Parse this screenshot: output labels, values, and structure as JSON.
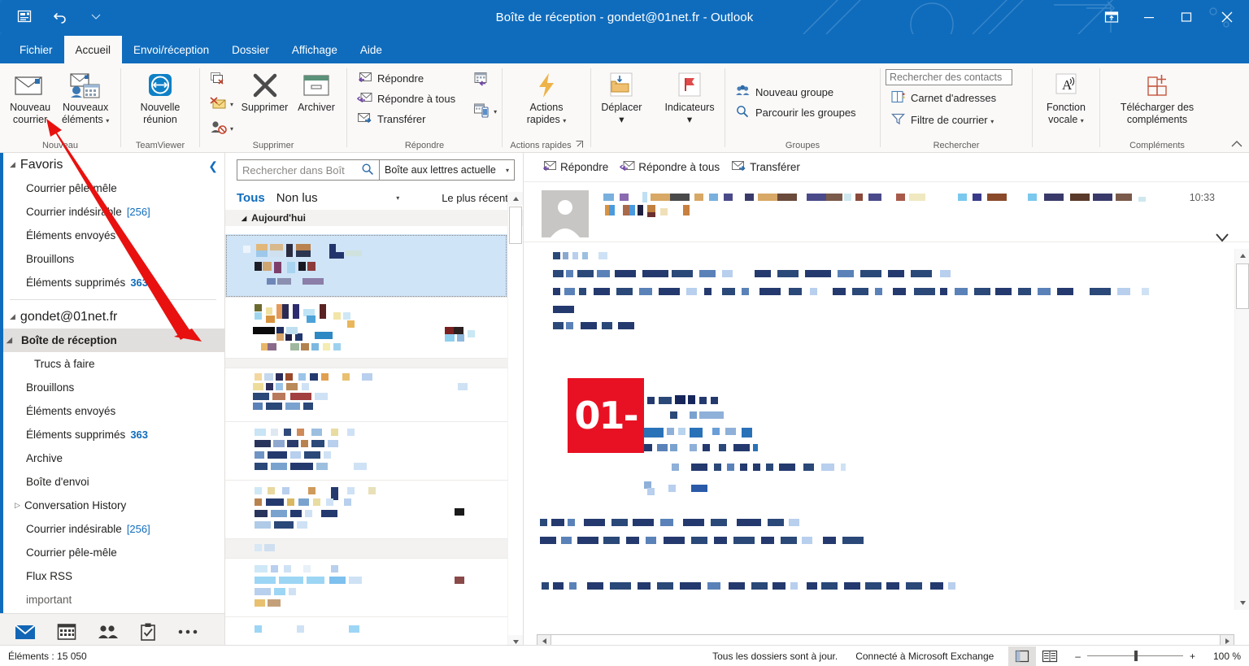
{
  "window": {
    "title": "Boîte de réception - gondet@01net.fr  -  Outlook",
    "qat": {
      "save_icon": "save-icon",
      "undo_icon": "undo-icon",
      "customize_icon": "chevron-down-icon"
    },
    "controls": {
      "ribbon_display": "ribbon-display-options-icon",
      "minimize": "–",
      "maximize": "☐",
      "close": "✕"
    },
    "accent_color": "#0f6cbd"
  },
  "tabs": [
    {
      "label": "Fichier",
      "active": false
    },
    {
      "label": "Accueil",
      "active": true
    },
    {
      "label": "Envoi/réception",
      "active": false
    },
    {
      "label": "Dossier",
      "active": false
    },
    {
      "label": "Affichage",
      "active": false
    },
    {
      "label": "Aide",
      "active": false
    }
  ],
  "ribbon": {
    "collapse_icon": "chevron-up-icon",
    "groups": [
      {
        "label": "Nouveau",
        "items": [
          {
            "label": "Nouveau courrier",
            "icon": "new-mail-icon",
            "type": "big"
          },
          {
            "label": "Nouveaux éléments",
            "icon": "new-items-icon",
            "type": "big",
            "caret": true
          }
        ]
      },
      {
        "label": "TeamViewer",
        "items": [
          {
            "label": "Nouvelle réunion",
            "icon": "teamviewer-icon",
            "type": "big"
          }
        ]
      },
      {
        "label": "Supprimer",
        "items": [
          {
            "label": "",
            "icon": "ignore-icon",
            "type": "icon"
          },
          {
            "label": "",
            "icon": "clean-up-icon",
            "type": "icon",
            "caret": true
          },
          {
            "label": "",
            "icon": "junk-icon",
            "type": "icon",
            "caret": true
          },
          {
            "label": "Supprimer",
            "icon": "delete-x-icon",
            "type": "big"
          },
          {
            "label": "Archiver",
            "icon": "archive-icon",
            "type": "big"
          }
        ]
      },
      {
        "label": "Répondre",
        "items": [
          {
            "label": "Répondre",
            "icon": "reply-icon",
            "type": "small"
          },
          {
            "label": "Répondre à tous",
            "icon": "reply-all-icon",
            "type": "small"
          },
          {
            "label": "Transférer",
            "icon": "forward-icon",
            "type": "small"
          },
          {
            "label": "",
            "icon": "meeting-reply-icon",
            "type": "icon"
          },
          {
            "label": "",
            "icon": "more-respond-icon",
            "type": "icon",
            "caret": true
          }
        ]
      },
      {
        "label": "Actions rapides",
        "dialog_launcher": true,
        "items": [
          {
            "label": "Actions rapides",
            "icon": "quick-steps-lightning-icon",
            "type": "big",
            "caret": true
          }
        ]
      },
      {
        "label": "",
        "items": [
          {
            "label": "Déplacer",
            "icon": "move-folder-icon",
            "type": "big",
            "caret": true
          },
          {
            "label": "Indicateurs",
            "icon": "flag-icon",
            "type": "big",
            "caret": true
          }
        ]
      },
      {
        "label": "Groupes",
        "items": [
          {
            "label": "Nouveau groupe",
            "icon": "new-group-icon",
            "type": "small"
          },
          {
            "label": "Parcourir les groupes",
            "icon": "browse-groups-icon",
            "type": "small"
          }
        ]
      },
      {
        "label": "Rechercher",
        "search_contacts_placeholder": "Rechercher des contacts",
        "items": [
          {
            "label": "Carnet d'adresses",
            "icon": "address-book-icon",
            "type": "small"
          },
          {
            "label": "Filtre de courrier",
            "icon": "filter-funnel-icon",
            "type": "small",
            "caret": true
          }
        ]
      },
      {
        "label": "",
        "items": [
          {
            "label": "Fonction vocale",
            "icon": "read-aloud-icon",
            "type": "big",
            "caret": true
          }
        ]
      },
      {
        "label": "Compléments",
        "items": [
          {
            "label": "Télécharger des compléments",
            "icon": "get-addins-icon",
            "type": "big"
          }
        ]
      }
    ]
  },
  "navpane": {
    "collapse_icon": "chevron-left-icon",
    "favorites": {
      "label": "Favoris",
      "items": [
        {
          "label": "Courrier pêle-mêle",
          "count": "",
          "count_style": ""
        },
        {
          "label": "Courrier indésirable",
          "count": "[256]",
          "count_style": "brackets"
        },
        {
          "label": "Éléments envoyés",
          "count": "",
          "count_style": ""
        },
        {
          "label": "Brouillons",
          "count": "",
          "count_style": ""
        },
        {
          "label": "Éléments supprimés",
          "count": "363",
          "count_style": "bold"
        }
      ]
    },
    "account": {
      "label": "gondet@01net.fr",
      "items": [
        {
          "label": "Boîte de réception",
          "count": "",
          "selected": true,
          "expandable": true,
          "indent": 0
        },
        {
          "label": "Trucs à faire",
          "count": "",
          "selected": false,
          "expandable": false,
          "indent": 1
        },
        {
          "label": "Brouillons",
          "count": "",
          "selected": false,
          "expandable": false,
          "indent": 0
        },
        {
          "label": "Éléments envoyés",
          "count": "",
          "selected": false,
          "expandable": false,
          "indent": 0
        },
        {
          "label": "Éléments supprimés",
          "count": "363",
          "selected": false,
          "expandable": false,
          "indent": 0
        },
        {
          "label": "Archive",
          "count": "",
          "selected": false,
          "expandable": false,
          "indent": 0
        },
        {
          "label": "Boîte d'envoi",
          "count": "",
          "selected": false,
          "expandable": false,
          "indent": 0
        },
        {
          "label": "Conversation History",
          "count": "",
          "selected": false,
          "expandable": true,
          "indent": 0
        },
        {
          "label": "Courrier indésirable",
          "count": "[256]",
          "selected": false,
          "expandable": false,
          "indent": 0
        },
        {
          "label": "Courrier pêle-mêle",
          "count": "",
          "selected": false,
          "expandable": false,
          "indent": 0
        },
        {
          "label": "Flux RSS",
          "count": "",
          "selected": false,
          "expandable": false,
          "indent": 0
        },
        {
          "label": "important",
          "count": "",
          "selected": false,
          "expandable": false,
          "indent": 0
        }
      ]
    },
    "module_bar": [
      {
        "icon": "mail-icon",
        "name": "mail",
        "active": true
      },
      {
        "icon": "calendar-icon",
        "name": "calendar",
        "active": false
      },
      {
        "icon": "people-icon",
        "name": "people",
        "active": false
      },
      {
        "icon": "tasks-icon",
        "name": "tasks",
        "active": false
      },
      {
        "icon": "more-options-icon",
        "name": "more",
        "active": false
      }
    ]
  },
  "messagelist": {
    "search_placeholder": "Rechercher dans Boît",
    "search_icon": "search-icon",
    "scope_label": "Boîte aux lettres actuelle",
    "scope_caret": "chevron-down-icon",
    "filter_all": "Tous",
    "filter_unread": "Non lus",
    "filter_caret": "chevron-down-icon",
    "sort_label": "Le plus récent",
    "sort_arrow": "↓",
    "group_header": "Aujourd'hui",
    "items_redacted": 8,
    "selected_index": 0,
    "scrollbar": {
      "up_icon": "triangle-up-icon",
      "down_icon": "triangle-down-icon"
    }
  },
  "readingpane": {
    "actions": [
      {
        "label": "Répondre",
        "icon": "reply-icon"
      },
      {
        "label": "Répondre à tous",
        "icon": "reply-all-icon"
      },
      {
        "label": "Transférer",
        "icon": "forward-icon"
      }
    ],
    "time": "10:33",
    "expand_icon": "chevron-down-icon",
    "avatar": "contact-avatar-icon",
    "logo_text": "01",
    "logo_color": "#e81123",
    "scroll": {
      "up_icon": "triangle-up-icon",
      "down_icon": "triangle-down-icon",
      "left_icon": "triangle-left-icon",
      "right_icon": "triangle-right-icon"
    }
  },
  "statusbar": {
    "items_label": "Éléments : 15 050",
    "sync_label": "Tous les dossiers sont à jour.",
    "connection_label": "Connecté à Microsoft Exchange",
    "view_normal_icon": "normal-view-icon",
    "view_reading_icon": "reading-view-icon",
    "zoom_out": "–",
    "zoom_in": "+",
    "zoom_level": "100 %"
  },
  "annotation": {
    "arrow_color": "#e8110f",
    "description": "red-arrow-pointing-to-nouveau-courrier"
  }
}
